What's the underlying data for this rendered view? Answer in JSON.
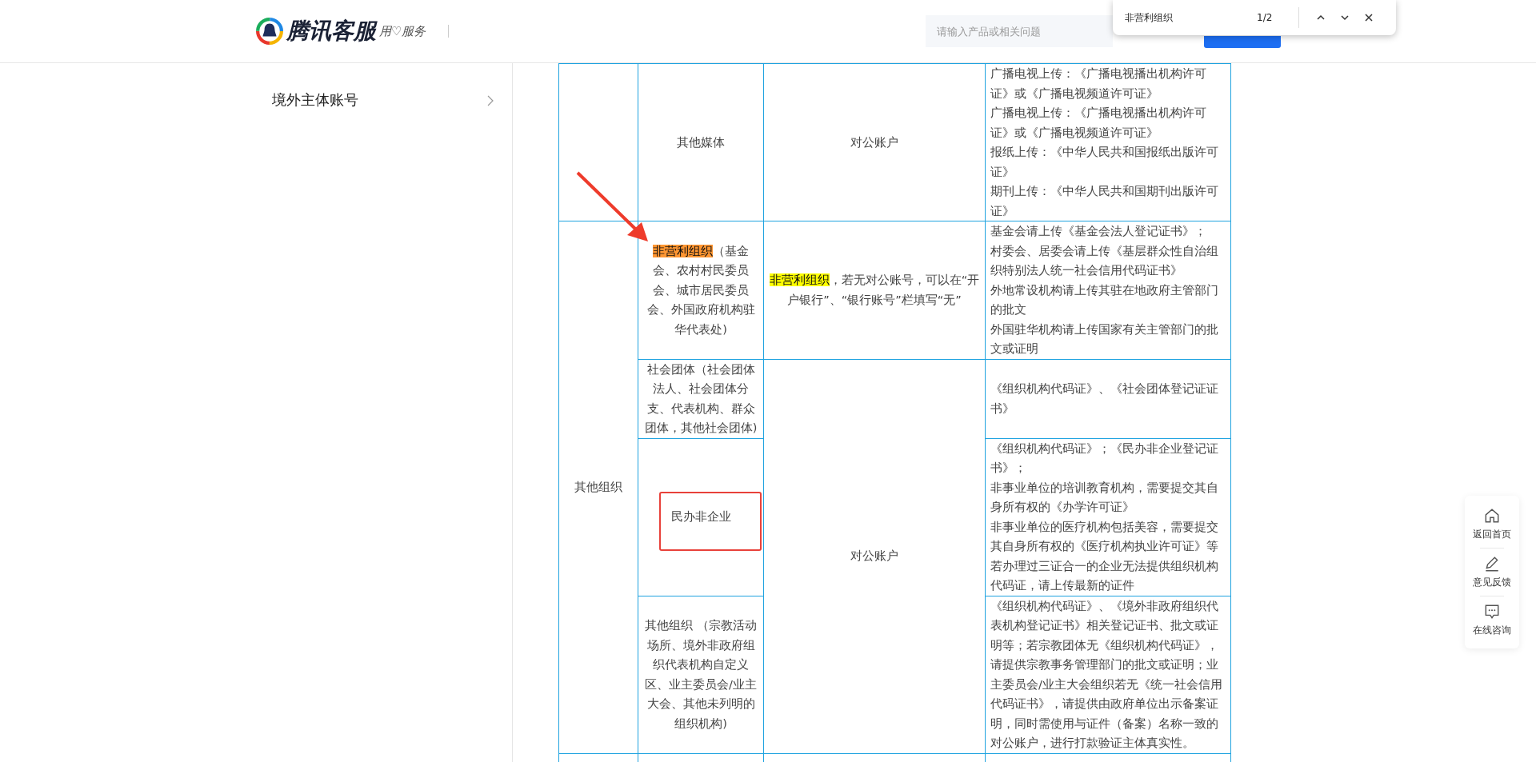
{
  "header": {
    "brand": "腾讯客服",
    "slogan": "用♡服务",
    "search": {
      "placeholder": "请输入产品或相关问题"
    }
  },
  "find_bar": {
    "query": "非营利组织",
    "count": "1/2"
  },
  "sidebar": {
    "items": [
      {
        "label": "境外主体账号"
      }
    ]
  },
  "table": {
    "sections": [
      {
        "account_groups": [
          {
            "account": [
              {
                "text": "对公账户"
              }
            ],
            "entries": [
              {
                "type": [
                  {
                    "text": "其他媒体"
                  }
                ],
                "materials": [
                  "广播电视上传：《广播电视播出机构许可证》或《广播电视频道许可证》",
                  "广播电视上传：《广播电视播出机构许可证》或《广播电视频道许可证》",
                  "报纸上传：《中华人民共和国报纸出版许可证》",
                  "期刊上传：《中华人民共和国期刊出版许可证》"
                ]
              }
            ]
          }
        ]
      },
      {
        "category": "其他组织",
        "account_groups": [
          {
            "account": [
              {
                "text": "非营利组织",
                "highlighted": true,
                "current": false
              },
              {
                "text": "，若无对公账号，可以在“开户银行”、“银行账号”栏填写“无”"
              }
            ],
            "entries": [
              {
                "type": [
                  {
                    "text": "非营利组织",
                    "highlighted": true,
                    "current": true
                  },
                  {
                    "text": "（基金会、农村村民委员会、城市居民委员会、外国政府机构驻华代表处)"
                  }
                ],
                "materials": [
                  "基金会请上传《基金会法人登记证书》；",
                  "村委会、居委会请上传《基层群众性自治组织特别法人统一社会信用代码证书》",
                  "外地常设机构请上传其驻在地政府主管部门的批文",
                  "外国驻华机构请上传国家有关主管部门的批文或证明"
                ]
              }
            ]
          },
          {
            "account": [
              {
                "text": "对公账户"
              }
            ],
            "entries": [
              {
                "type": [
                  {
                    "text": "社会团体（社会团体法人、社会团体分支、代表机构、群众团体，其他社会团体)"
                  }
                ],
                "materials": [
                  "《组织机构代码证》、《社会团体登记证证书》"
                ]
              },
              {
                "type": [
                  {
                    "text": "民办非企业"
                  }
                ],
                "materials": [
                  "《组织机构代码证》；《民办非企业登记证书》；",
                  "非事业单位的培训教育机构，需要提交其自身所有权的《办学许可证》",
                  "非事业单位的医疗机构包括美容，需要提交其自身所有权的《医疗机构执业许可证》等",
                  "若办理过三证合一的企业无法提供组织机构代码证，请上传最新的证件"
                ]
              },
              {
                "type": [
                  {
                    "text": "其他组织 （宗教活动场所、境外非政府组织代表机构自定义区、业主委员会/业主大会、其他未列明的组织机构)"
                  }
                ],
                "materials": [
                  "《组织机构代码证》、《境外非政府组织代表机构登记证书》相关登记证书、批文或证明等；若宗教团体无《组织机构代码证》，请提供宗教事务管理部门的批文或证明；业主委员会/业主大会组织若无《统一社会信用代码证书》，请提供由政府单位出示备案证明，同时需使用与证件（备案）名称一致的对公账户，进行打款验证主体真实性。"
                ]
              }
            ]
          }
        ]
      }
    ]
  },
  "annotations": {
    "arrow": true,
    "frame": true
  },
  "float_panel": {
    "items": [
      {
        "kind": "home",
        "label": "返回首页"
      },
      {
        "kind": "feedback",
        "label": "意见反馈"
      },
      {
        "kind": "chat",
        "label": "在线咨询"
      }
    ]
  }
}
